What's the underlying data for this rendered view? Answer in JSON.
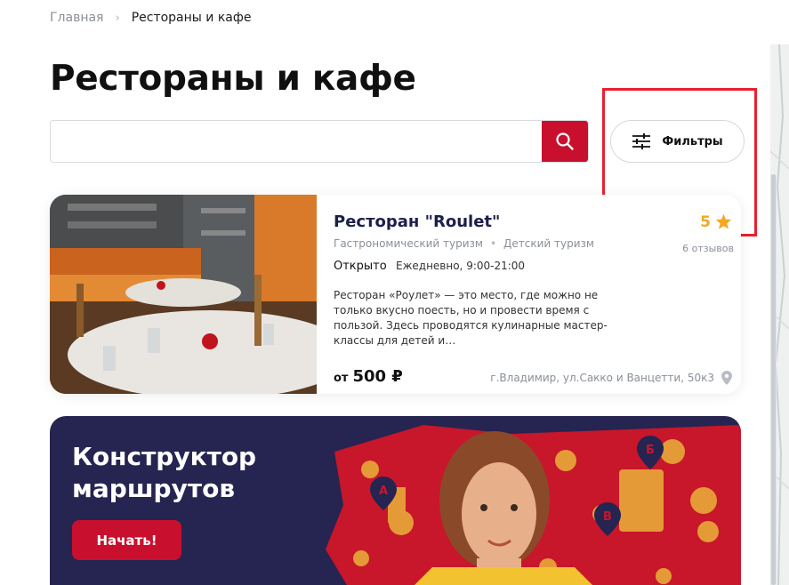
{
  "breadcrumb": {
    "home": "Главная",
    "separator": "›",
    "current": "Рестораны и кафе"
  },
  "page": {
    "title": "Рестораны и кафе"
  },
  "search": {
    "value": "",
    "placeholder": "",
    "button_icon": "search-icon"
  },
  "filters": {
    "label": "Фильтры",
    "icon": "sliders-icon"
  },
  "card": {
    "title": "Ресторан \"Roulet\"",
    "tags": [
      "Гастрономический туризм",
      "Детский туризм"
    ],
    "status": "Открыто",
    "hours": "Ежедневно, 9:00-21:00",
    "description": "Ресторан «Роулет» — это место, где можно не только вкусно поесть, но и провести время с пользой. Здесь проводятся кулинарные мастер-классы для детей и…",
    "rating": "5",
    "reviews": "6 отзывов",
    "price_prefix": "от",
    "price": "500 ₽",
    "address": "г.Владимир, ул.Сакко и Ванцетти, 50к3"
  },
  "banner": {
    "title": "Конструктор маршрутов",
    "button": "Начать!",
    "markers": [
      "А",
      "Б",
      "В"
    ]
  },
  "colors": {
    "accent": "#c8102e",
    "rating": "#f5a623",
    "banner_bg": "#262450",
    "highlight": "#e8202e"
  }
}
